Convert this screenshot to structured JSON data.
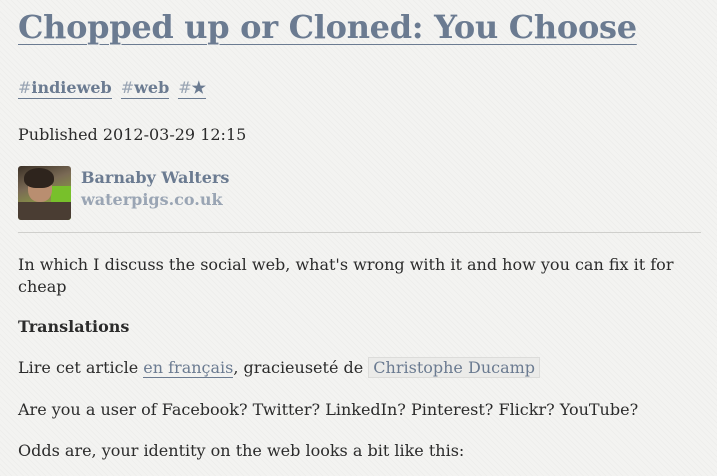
{
  "article": {
    "title": "Chopped up or Cloned: You Choose",
    "tags": [
      {
        "hash": "#",
        "label": "indieweb"
      },
      {
        "hash": "#",
        "label": "web"
      },
      {
        "hash": "#",
        "label": "★"
      }
    ],
    "published": "Published 2012-03-29 12:15",
    "author": {
      "name": "Barnaby Walters",
      "url": "waterpigs.co.uk"
    },
    "summary": "In which I discuss the social web, what's wrong with it and how you can fix it for cheap",
    "translations_heading": "Translations",
    "translation_line": {
      "prefix": "Lire cet article ",
      "link": "en français",
      "middle": ", gracieuseté de ",
      "credit": "Christophe Ducamp"
    },
    "paragraphs": [
      "Are you a user of Facebook? Twitter? LinkedIn? Pinterest? Flickr? YouTube?",
      "Odds are, your identity on the web looks a bit like this:"
    ]
  }
}
